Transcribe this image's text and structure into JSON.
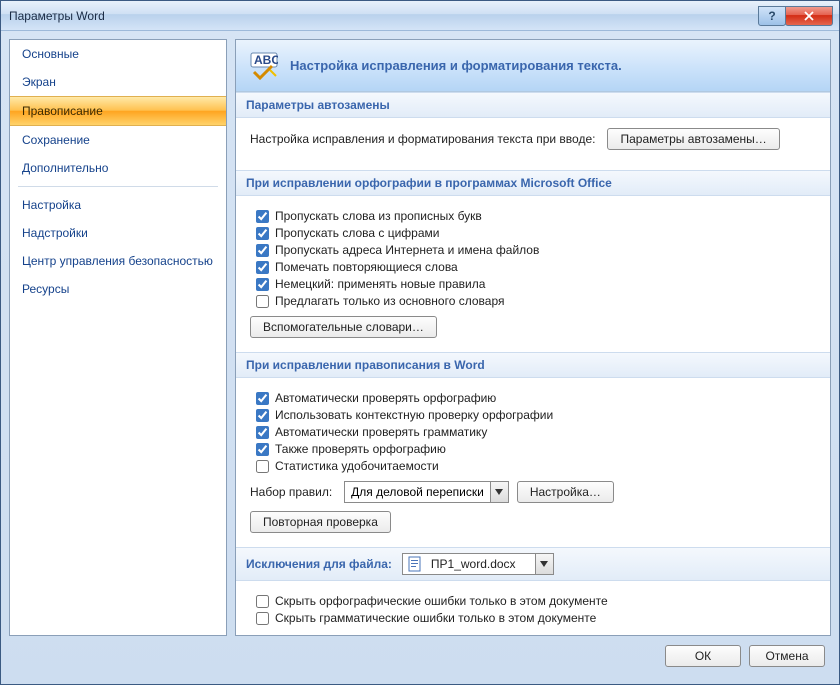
{
  "window_title": "Параметры Word",
  "sidebar": {
    "items": [
      {
        "label": "Основные"
      },
      {
        "label": "Экран"
      },
      {
        "label": "Правописание",
        "selected": true
      },
      {
        "label": "Сохранение"
      },
      {
        "label": "Дополнительно"
      }
    ],
    "items2": [
      {
        "label": "Настройка"
      },
      {
        "label": "Надстройки"
      },
      {
        "label": "Центр управления безопасностью"
      },
      {
        "label": "Ресурсы"
      }
    ]
  },
  "banner": "Настройка исправления и форматирования текста.",
  "section1": {
    "title": "Параметры автозамены",
    "text": "Настройка исправления и форматирования текста при вводе:",
    "button": "Параметры автозамены…"
  },
  "section2": {
    "title": "При исправлении орфографии в программах Microsoft Office",
    "c1": "Пропускать слова из прописных букв",
    "c2": "Пропускать слова с цифрами",
    "c3": "Пропускать адреса Интернета и имена файлов",
    "c4": "Помечать повторяющиеся слова",
    "c5": "Немецкий: применять новые правила",
    "c6": "Предлагать только из основного словаря",
    "button": "Вспомогательные словари…"
  },
  "section3": {
    "title": "При исправлении правописания в Word",
    "c1": "Автоматически проверять орфографию",
    "c2": "Использовать контекстную проверку орфографии",
    "c3": "Автоматически проверять грамматику",
    "c4": "Также проверять орфографию",
    "c5": "Статистика удобочитаемости",
    "rules_label": "Набор правил:",
    "rules_value": "Для деловой переписки",
    "settings_btn": "Настройка…",
    "recheck_btn": "Повторная проверка"
  },
  "section4": {
    "title": "Исключения для файла:",
    "file": "ПР1_word.docx",
    "c1": "Скрыть орфографические ошибки только в этом документе",
    "c2": "Скрыть грамматические ошибки только в этом документе"
  },
  "footer": {
    "ok": "ОК",
    "cancel": "Отмена"
  }
}
